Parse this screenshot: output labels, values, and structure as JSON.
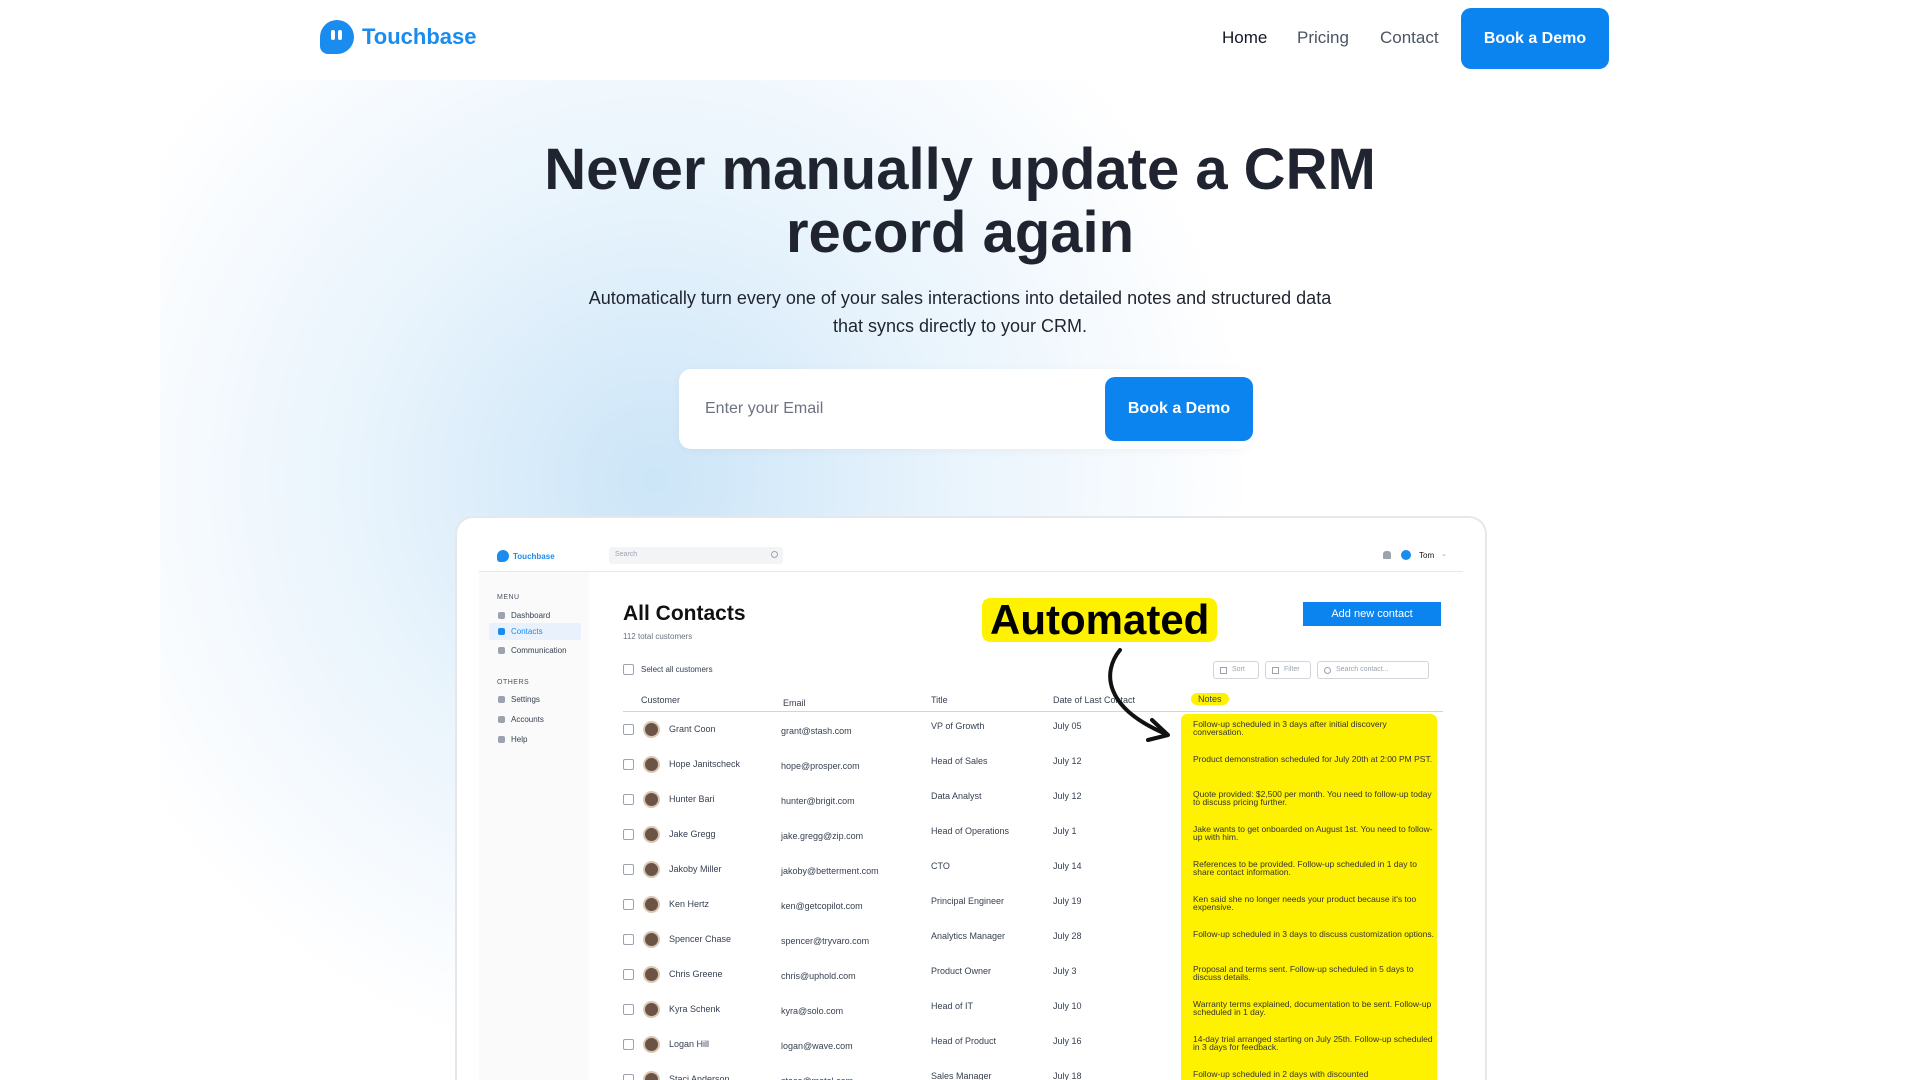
{
  "nav": {
    "brand": "Touchbase",
    "links": [
      "Home",
      "Pricing",
      "Contact"
    ],
    "cta": "Book a Demo"
  },
  "hero": {
    "title_line1": "Never manually update a CRM",
    "title_line2": "record again",
    "subtitle_line1": "Automatically turn every one of your sales interactions into detailed notes and structured data",
    "subtitle_line2": "that syncs directly to your CRM.",
    "email_placeholder": "Enter your Email",
    "cta": "Book a Demo"
  },
  "app": {
    "brand": "Touchbase",
    "search_placeholder": "Search",
    "user": "Tom",
    "sidebar": {
      "menu_heading": "MENU",
      "menu_items": [
        "Dashboard",
        "Contacts",
        "Communication"
      ],
      "others_heading": "OTHERS",
      "other_items": [
        "Settings",
        "Accounts",
        "Help"
      ]
    },
    "title": "All Contacts",
    "subtitle": "112 total customers",
    "highlight": "Automated",
    "add_button": "Add new contact",
    "select_all": "Select all customers",
    "tools": {
      "sort": "Sort",
      "filter": "Filter",
      "search": "Search contact..."
    },
    "columns": [
      "Customer",
      "Email",
      "Title",
      "Date of Last Contact",
      "Notes"
    ],
    "rows": [
      {
        "name": "Grant Coon",
        "email": "grant@stash.com",
        "title": "VP of Growth",
        "date": "July 05",
        "note": "Follow-up scheduled in 3 days after initial discovery conversation."
      },
      {
        "name": "Hope Janitscheck",
        "email": "hope@prosper.com",
        "title": "Head of Sales",
        "date": "July 12",
        "note": "Product demonstration scheduled for July 20th at 2:00 PM PST."
      },
      {
        "name": "Hunter Bari",
        "email": "hunter@brigit.com",
        "title": "Data Analyst",
        "date": "July 12",
        "note": "Quote provided: $2,500 per month. You need to follow-up today to discuss pricing further."
      },
      {
        "name": "Jake Gregg",
        "email": "jake.gregg@zip.com",
        "title": "Head of Operations",
        "date": "July 1",
        "note": "Jake wants to get onboarded on August 1st. You need to follow-up with him."
      },
      {
        "name": "Jakoby Miller",
        "email": "jakoby@betterment.com",
        "title": "CTO",
        "date": "July 14",
        "note": "References to be provided. Follow-up scheduled in 1 day to share contact information."
      },
      {
        "name": "Ken Hertz",
        "email": "ken@getcopilot.com",
        "title": "Principal Engineer",
        "date": "July 19",
        "note": "Ken said she no longer needs your product because it's too expensive."
      },
      {
        "name": "Spencer Chase",
        "email": "spencer@tryvaro.com",
        "title": "Analytics Manager",
        "date": "July 28",
        "note": "Follow-up scheduled in 3 days to discuss customization options."
      },
      {
        "name": "Chris Greene",
        "email": "chris@uphold.com",
        "title": "Product Owner",
        "date": "July 3",
        "note": "Proposal and terms sent. Follow-up scheduled in 5 days to discuss details."
      },
      {
        "name": "Kyra Schenk",
        "email": "kyra@solo.com",
        "title": "Head of IT",
        "date": "July 10",
        "note": "Warranty terms explained, documentation to be sent. Follow-up scheduled in 1 day."
      },
      {
        "name": "Logan Hill",
        "email": "logan@wave.com",
        "title": "Head of Product",
        "date": "July 16",
        "note": "14-day trial arranged starting on July 25th. Follow-up scheduled in 3 days for feedback."
      },
      {
        "name": "Staci Anderson",
        "email": "stace@metal.com",
        "title": "Sales Manager",
        "date": "July 18",
        "note": "Follow-up scheduled in 2 days with discounted"
      }
    ]
  },
  "colors": {
    "brand": "#1a8cf0",
    "highlight": "#fff200"
  }
}
